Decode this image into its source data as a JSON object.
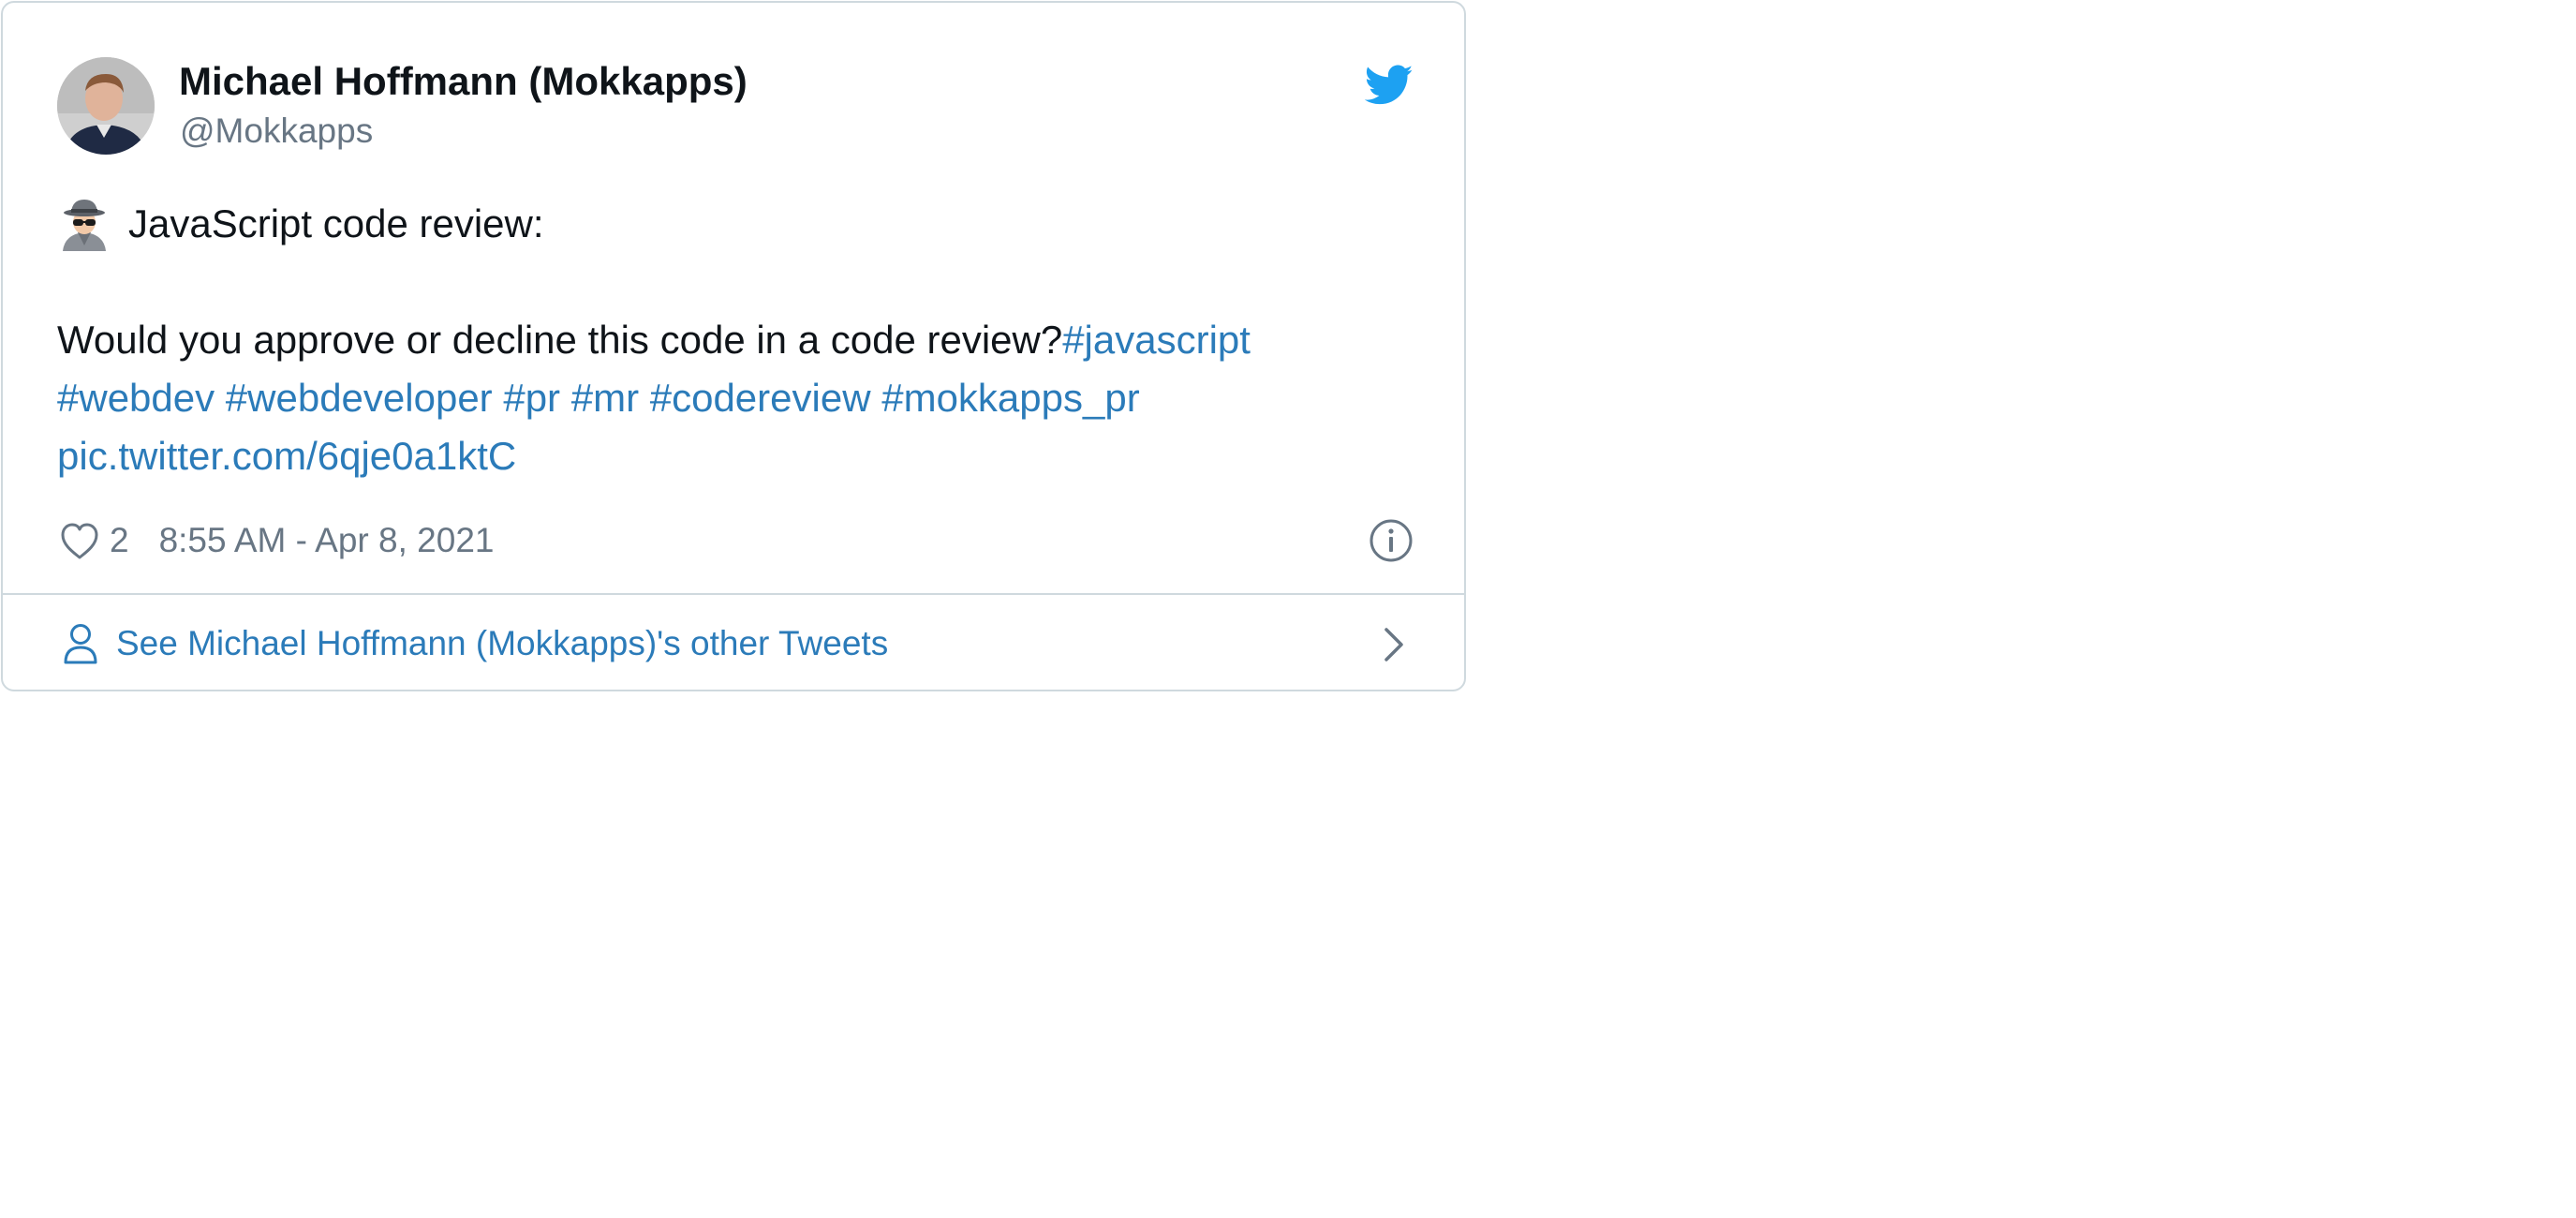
{
  "tweet": {
    "author": {
      "display_name": "Michael Hoffmann (Mokkapps)",
      "handle": "@Mokkapps",
      "avatar_icon": "avatar"
    },
    "brand_icon": "twitter-bird-icon",
    "brand_color": "#1da1f2",
    "link_color": "#2b7bb9",
    "body": {
      "intro_emoji": "spy-emoji",
      "intro_text": "JavaScript code review:",
      "paragraph_text": "Would you approve or decline this code in a code review?",
      "hashtags": [
        "#javascript",
        "#webdev",
        "#webdeveloper",
        "#pr",
        "#mr",
        "#codereview",
        "#mokkapps_pr"
      ],
      "pic_link": "pic.twitter.com/6qje0a1ktC"
    },
    "meta": {
      "like_icon": "heart-icon",
      "like_count": "2",
      "timestamp": "8:55 AM - Apr 8, 2021",
      "info_icon": "info-icon"
    },
    "footer": {
      "person_icon": "person-icon",
      "other_tweets_label": "See Michael Hoffmann (Mokkapps)'s other Tweets",
      "chevron_icon": "chevron-right-icon"
    }
  }
}
